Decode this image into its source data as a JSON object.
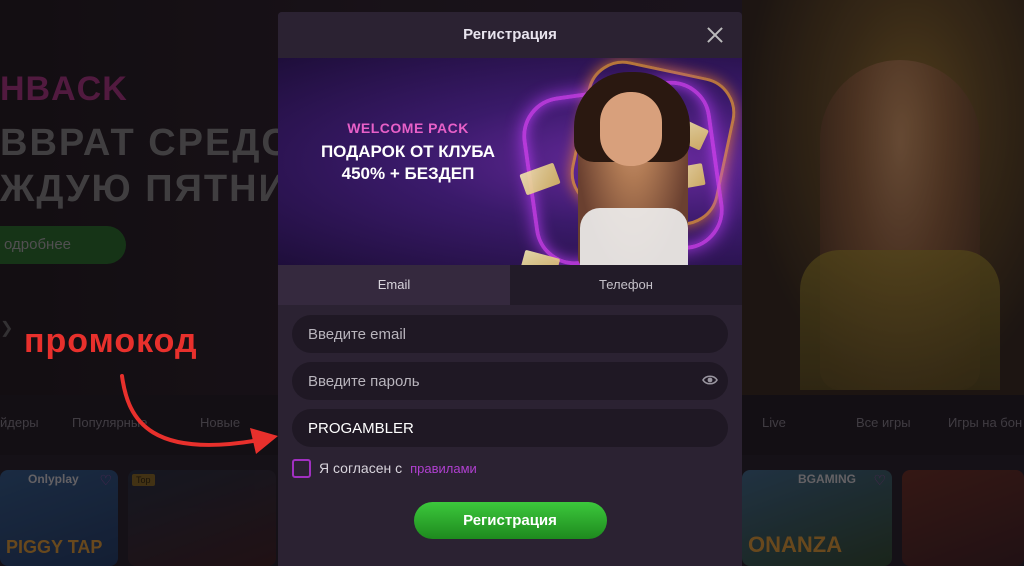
{
  "background": {
    "hero_tag": "НBACK",
    "hero_line1": "ВВРАТ СРЕДСТ",
    "hero_line2": "ЖДУЮ ПЯТНИ",
    "more_button": "одробнее",
    "nav": {
      "items": [
        "йдеры",
        "Популярные",
        "Новые",
        "Live",
        "Все игры",
        "Игры на бон"
      ]
    },
    "games": [
      {
        "provider": "Onlyplay",
        "title": "PIGGY TAP"
      },
      {
        "badge": "Top",
        "title": ""
      },
      {
        "provider": "BGAMING",
        "title": "ONANZA"
      },
      {
        "title": ""
      }
    ]
  },
  "annotation": {
    "promo_label": "промокод"
  },
  "modal": {
    "title": "Регистрация",
    "banner": {
      "pack": "WELCOME PACK",
      "line1": "ПОДАРОК ОТ КЛУБА",
      "line2": "450% + БЕЗДЕП"
    },
    "tabs": [
      {
        "label": "Email",
        "active": true
      },
      {
        "label": "Телефон",
        "active": false
      }
    ],
    "fields": {
      "email_placeholder": "Введите email",
      "password_placeholder": "Введите пароль",
      "promo_value": "PROGAMBLER"
    },
    "agree": {
      "text": "Я согласен с",
      "link": "правилами"
    },
    "submit_label": "Регистрация"
  },
  "colors": {
    "accent_purple": "#b040d0",
    "submit_green": "#2aa82a",
    "annotation_red": "#e8302c"
  }
}
